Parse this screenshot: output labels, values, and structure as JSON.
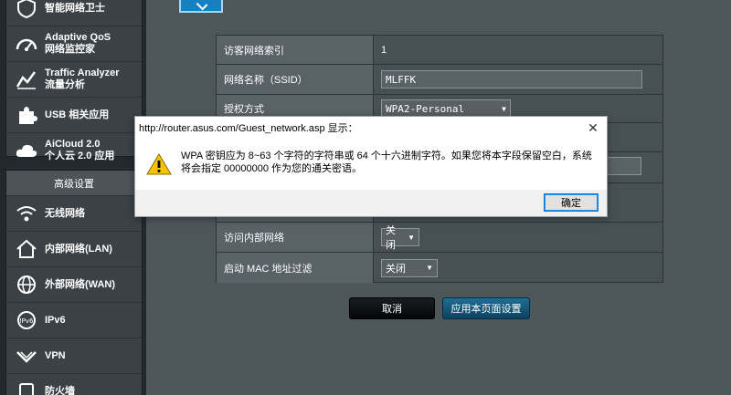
{
  "sidebar": {
    "general_items": [
      {
        "l1": "智能网络卫士",
        "l2": "",
        "icon": "shield-icon"
      },
      {
        "l1": "Adaptive QoS",
        "l2": "网络监控家",
        "icon": "speedometer-icon"
      },
      {
        "l1": "Traffic Analyzer",
        "l2": "流量分析",
        "icon": "chart-icon"
      },
      {
        "l1": "USB 相关应用",
        "l2": "",
        "icon": "puzzle-icon"
      },
      {
        "l1": "AiCloud 2.0",
        "l2": "个人云 2.0 应用",
        "icon": "cloud-icon"
      }
    ],
    "advanced_header": "高级设置",
    "advanced_items": [
      {
        "label": "无线网络",
        "icon": "wifi-icon"
      },
      {
        "label": "内部网络(LAN)",
        "icon": "home-icon"
      },
      {
        "label": "外部网络(WAN)",
        "icon": "globe-icon"
      },
      {
        "label": "IPv6",
        "icon": "ipv6-icon"
      },
      {
        "label": "VPN",
        "icon": "vpn-icon"
      },
      {
        "label": "防火墙",
        "icon": "firewall-icon"
      }
    ]
  },
  "form": {
    "rows": [
      {
        "label": "访客网络索引",
        "value": "1"
      },
      {
        "label": "网络名称（SSID）",
        "value": "MLFFK"
      },
      {
        "label": "授权方式",
        "value": "WPA2-Personal"
      }
    ],
    "access_intranet": {
      "label": "访问内部网络",
      "value": "关闭"
    },
    "mac_filter": {
      "label": "启动 MAC 地址过滤",
      "value": "关闭"
    }
  },
  "buttons": {
    "cancel": "取消",
    "apply": "应用本页面设置"
  },
  "dialog": {
    "title": "http://router.asus.com/Guest_network.asp 显示：",
    "message": "WPA 密钥应为 8~63 个字符的字符串或 64 个十六进制字符。如果您将本字段保留空白，系统将会指定 00000000 作为您的通关密语。",
    "ok": "确定",
    "close_glyph": "✕"
  },
  "colors": {
    "accent": "#1680c2",
    "apply_button": "#1f6e95",
    "warning": "#f5c400"
  }
}
